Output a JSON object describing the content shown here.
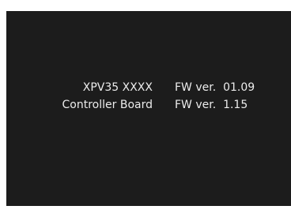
{
  "components": [
    {
      "name": "XPV35 XXXX",
      "fw_label": "FW ver.",
      "fw_version": "01.09"
    },
    {
      "name": "Controller Board",
      "fw_label": "FW ver.",
      "fw_version": "1.15"
    }
  ],
  "colors": {
    "screen_background": "#1c1c1c",
    "text": "#ececec",
    "page_background": "#ffffff"
  }
}
